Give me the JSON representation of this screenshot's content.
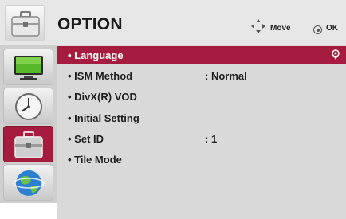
{
  "header": {
    "title": "OPTION",
    "hint_move": "Move",
    "hint_ok": "OK",
    "header_icon": "toolbox-icon"
  },
  "sidebar": {
    "items": [
      {
        "icon": "tv-picture-icon",
        "active": false
      },
      {
        "icon": "clock-icon",
        "active": false
      },
      {
        "icon": "toolbox-icon",
        "active": true
      },
      {
        "icon": "globe-icon",
        "active": false
      }
    ]
  },
  "menu": {
    "items": [
      {
        "label": "• Language",
        "value": "",
        "selected": true
      },
      {
        "label": "• ISM Method",
        "value": ": Normal",
        "selected": false
      },
      {
        "label": "• DivX(R) VOD",
        "value": "",
        "selected": false
      },
      {
        "label": "• Initial Setting",
        "value": "",
        "selected": false
      },
      {
        "label": "• Set ID",
        "value": ": 1",
        "selected": false
      },
      {
        "label": "• Tile Mode",
        "value": "",
        "selected": false
      }
    ]
  },
  "colors": {
    "accent": "#a51c3e",
    "header_bg": "#e6e6e6",
    "panel_bg": "#d9d9d9",
    "sidebar_bg": "#cfcfcf"
  }
}
